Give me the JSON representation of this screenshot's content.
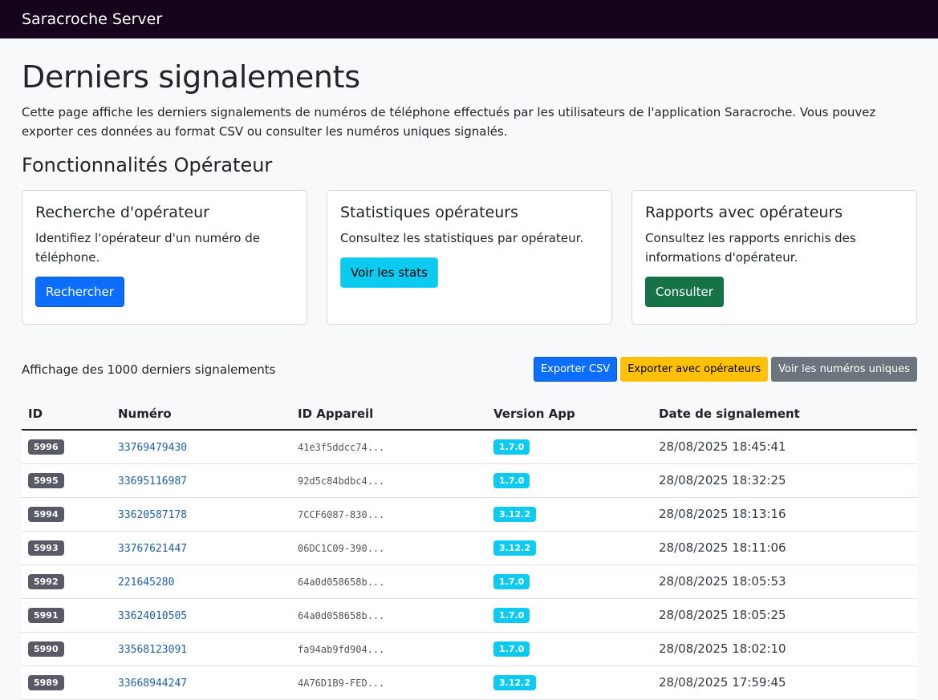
{
  "navbar": {
    "brand": "Saracroche Server"
  },
  "page": {
    "title": "Derniers signalements",
    "lead": "Cette page affiche les derniers signalements de numéros de téléphone effectués par les utilisateurs de l'application Saracroche. Vous pouvez exporter ces données au format CSV ou consulter les numéros uniques signalés.",
    "section_title": "Fonctionnalités Opérateur"
  },
  "cards": [
    {
      "title": "Recherche d'opérateur",
      "text": "Identifiez l'opérateur d'un numéro de téléphone.",
      "button": "Rechercher"
    },
    {
      "title": "Statistiques opérateurs",
      "text": "Consultez les statistiques par opérateur.",
      "button": "Voir les stats"
    },
    {
      "title": "Rapports avec opérateurs",
      "text": "Consultez les rapports enrichis des informations d'opérateur.",
      "button": "Consulter"
    }
  ],
  "toolbar": {
    "summary": "Affichage des 1000 derniers signalements",
    "export_csv": "Exporter CSV",
    "export_operators": "Exporter avec opérateurs",
    "unique_numbers": "Voir les numéros uniques"
  },
  "table": {
    "headers": [
      "ID",
      "Numéro",
      "ID Appareil",
      "Version App",
      "Date de signalement"
    ],
    "rows": [
      {
        "id": "5996",
        "number": "33769479430",
        "device": "41e3f5ddcc74...",
        "version": "1.7.0",
        "date": "28/08/2025 18:45:41"
      },
      {
        "id": "5995",
        "number": "33695116987",
        "device": "92d5c84bdbc4...",
        "version": "1.7.0",
        "date": "28/08/2025 18:32:25"
      },
      {
        "id": "5994",
        "number": "33620587178",
        "device": "7CCF6087-830...",
        "version": "3.12.2",
        "date": "28/08/2025 18:13:16"
      },
      {
        "id": "5993",
        "number": "33767621447",
        "device": "06DC1C09-390...",
        "version": "3.12.2",
        "date": "28/08/2025 18:11:06"
      },
      {
        "id": "5992",
        "number": "221645280",
        "device": "64a0d058658b...",
        "version": "1.7.0",
        "date": "28/08/2025 18:05:53"
      },
      {
        "id": "5991",
        "number": "33624010505",
        "device": "64a0d058658b...",
        "version": "1.7.0",
        "date": "28/08/2025 18:05:25"
      },
      {
        "id": "5990",
        "number": "33568123091",
        "device": "fa94ab9fd904...",
        "version": "1.7.0",
        "date": "28/08/2025 18:02:10"
      },
      {
        "id": "5989",
        "number": "33668944247",
        "device": "4A76D1B9-FED...",
        "version": "3.12.2",
        "date": "28/08/2025 17:59:45"
      }
    ]
  }
}
